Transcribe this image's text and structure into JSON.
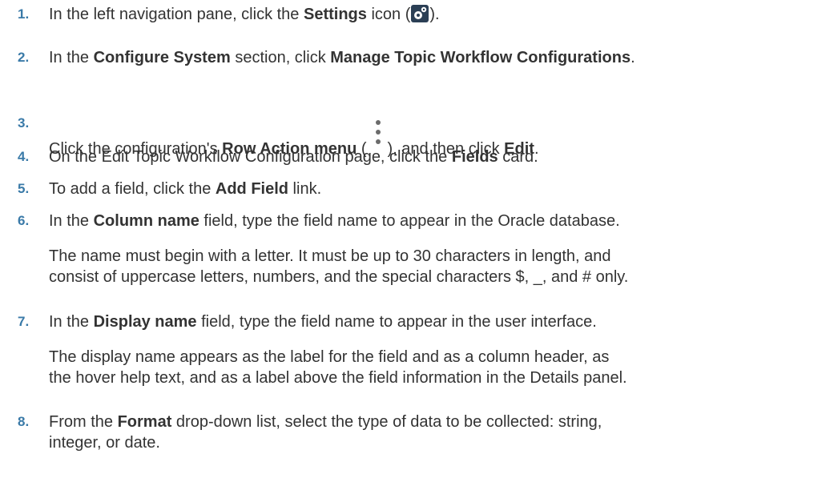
{
  "steps": [
    {
      "num": "1.",
      "parts": [
        "In the left navigation pane, click the ",
        "Settings",
        " icon (",
        ")."
      ]
    },
    {
      "num": "2.",
      "parts": [
        "In the ",
        "Configure System",
        " section, click ",
        "Manage Topic Workflow Configurations",
        "."
      ]
    },
    {
      "num": "3.",
      "parts": [
        "Click the configuration's ",
        "Row Action menu",
        " (",
        "), and then click ",
        "Edit",
        "."
      ]
    },
    {
      "num": "4.",
      "parts": [
        "On the Edit Topic Workflow Configuration page, click the ",
        "Fields",
        " card."
      ]
    },
    {
      "num": "5.",
      "parts": [
        "To add a field, click the ",
        "Add Field",
        " link."
      ]
    },
    {
      "num": "6.",
      "parts": [
        "In the ",
        "Column name",
        " field, type the field name to appear in the Oracle database."
      ],
      "note": [
        "The name must begin with a letter. It must be up to 30 characters in length, and",
        "consist of uppercase letters, numbers, and the special characters $, _, and # only."
      ]
    },
    {
      "num": "7.",
      "parts": [
        "In the ",
        "Display name",
        " field, type the field name to appear in the user interface."
      ],
      "note": [
        "The display name appears as the label for the field and as a column header, as",
        "the hover help text, and as a label above the field information in the Details panel."
      ]
    },
    {
      "num": "8.",
      "parts": [
        "From the ",
        "Format",
        " drop-down list, select the type of data to be collected: string,"
      ],
      "cont": "integer, or date."
    }
  ],
  "icons": {
    "settings": "gear-icon",
    "row_action": "kebab-menu-icon"
  },
  "colors": {
    "step_number": "#3a7aa8",
    "text": "#333333",
    "settings_icon_bg": "#2b3f55"
  }
}
